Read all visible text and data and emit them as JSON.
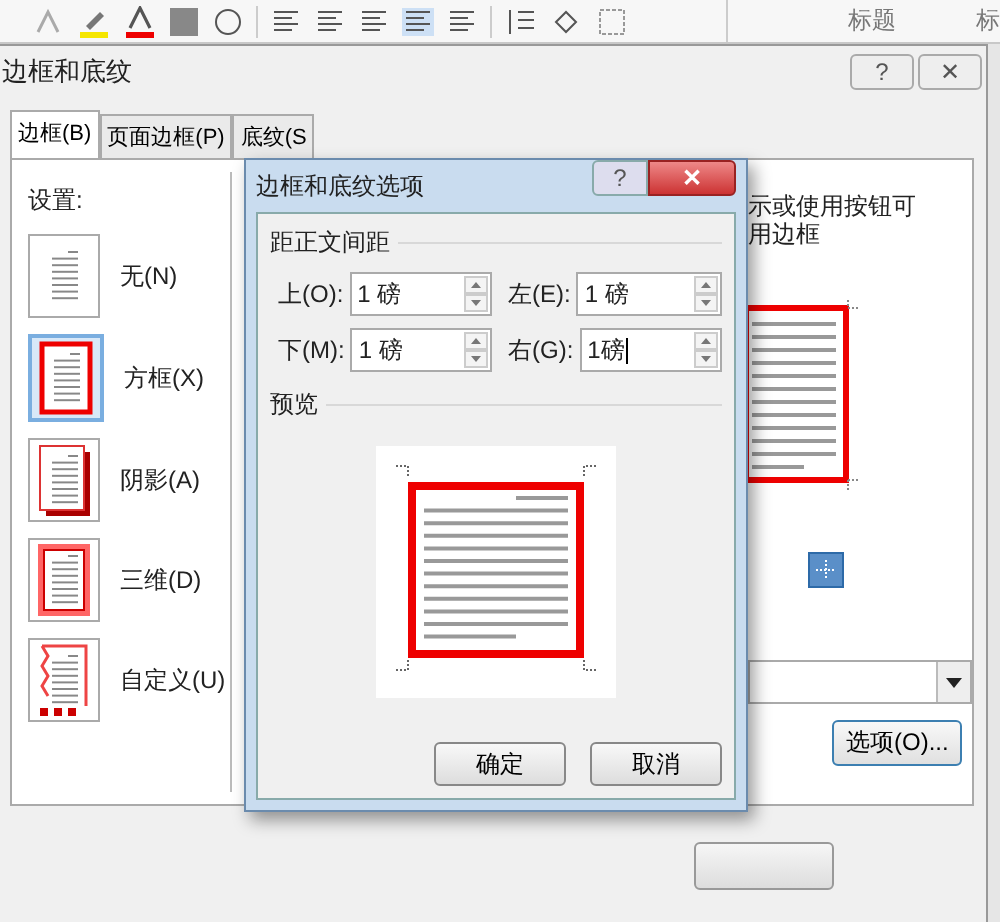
{
  "ribbon": {
    "style_labels": [
      "标题",
      "标"
    ]
  },
  "window": {
    "title": "边框和底纹",
    "help": "?",
    "close": "✕"
  },
  "tabs": [
    {
      "label": "边框(B)",
      "selected": true
    },
    {
      "label": "页面边框(P)",
      "selected": false
    },
    {
      "label": "底纹(S",
      "selected": false
    }
  ],
  "settings": {
    "label": "设置:",
    "items": [
      {
        "label": "无(N)",
        "kind": "none",
        "selected": false
      },
      {
        "label": "方框(X)",
        "kind": "box",
        "selected": true
      },
      {
        "label": "阴影(A)",
        "kind": "shadow",
        "selected": false
      },
      {
        "label": "三维(D)",
        "kind": "threed",
        "selected": false
      },
      {
        "label": "自定义(U)",
        "kind": "custom",
        "selected": false
      }
    ]
  },
  "preview": {
    "hint_lines": [
      "示或使用按钮可",
      "用边框"
    ]
  },
  "options_button": "选项(O)...",
  "options_dialog": {
    "title": "边框和底纹选项",
    "help": "?",
    "close": "✕",
    "group": "距正文间距",
    "fields": [
      {
        "label": "上(O):",
        "value": "1 磅"
      },
      {
        "label": "左(E):",
        "value": "1 磅"
      },
      {
        "label": "下(M):",
        "value": "1 磅"
      },
      {
        "label": "右(G):",
        "value": "1磅",
        "focused": true
      }
    ],
    "preview_label": "预览",
    "buttons": [
      "确定",
      "取消"
    ]
  }
}
